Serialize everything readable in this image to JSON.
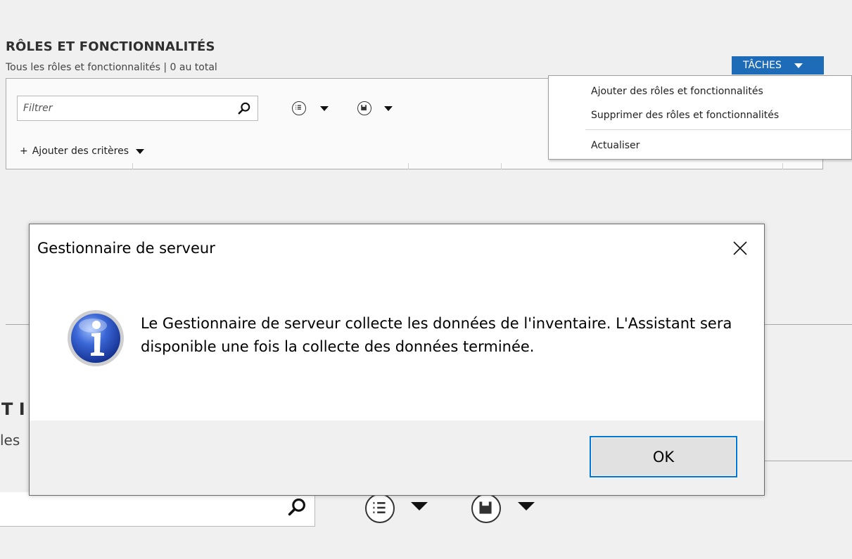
{
  "panel": {
    "title": "RÔLES ET FONCTIONNALITÉS",
    "subtitle": "Tous les rôles et fonctionnalités | 0 au total",
    "filter_placeholder": "Filtrer",
    "add_criteria": "Ajouter des critères",
    "add_criteria_icon": "+"
  },
  "tasks": {
    "button_label": "TÂCHES",
    "menu": [
      "Ajouter des rôles et fonctionnalités",
      "Supprimer des rôles et fonctionnalités",
      "Actualiser"
    ]
  },
  "background_fragments": {
    "heading_fragment": "T I",
    "subtitle_fragment": "les"
  },
  "dialog": {
    "title": "Gestionnaire de serveur",
    "message": "Le Gestionnaire de serveur collecte les données de l'inventaire. L'Assistant sera disponible une fois la collecte des données terminée.",
    "ok_label": "OK",
    "icon": "information-icon"
  },
  "colors": {
    "accent": "#1e6bb8",
    "ok_border": "#0078d7",
    "info_blue": "#1f4fbf"
  }
}
